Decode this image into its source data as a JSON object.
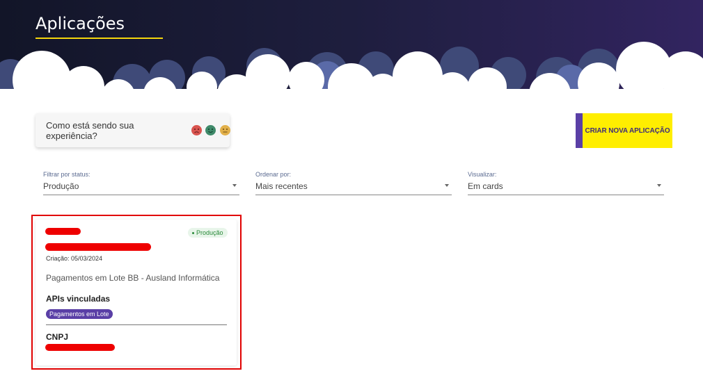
{
  "header": {
    "title": "Aplicações"
  },
  "feedback": {
    "question": "Como está sendo sua experiência?",
    "faces": [
      "sad-face",
      "happy-face",
      "neutral-face"
    ]
  },
  "actions": {
    "create_label": "CRIAR NOVA APLICAÇÃO"
  },
  "filters": [
    {
      "label": "Filtrar por status:",
      "value": "Produção"
    },
    {
      "label": "Ordenar por:",
      "value": "Mais recentes"
    },
    {
      "label": "Visualizar:",
      "value": "Em cards"
    }
  ],
  "card": {
    "status": "Produção",
    "created": "Criação: 05/03/2024",
    "description": "Pagamentos em Lote BB - Ausland Informática",
    "apis_title": "APIs vinculadas",
    "api_chip": "Pagamentos em Lote",
    "cnpj_title": "CNPJ"
  },
  "colors": {
    "brand_purple": "#5a3fa6",
    "brand_yellow": "#ffee00",
    "status_green": "#2a8a3a",
    "highlight_red": "#e00000"
  }
}
